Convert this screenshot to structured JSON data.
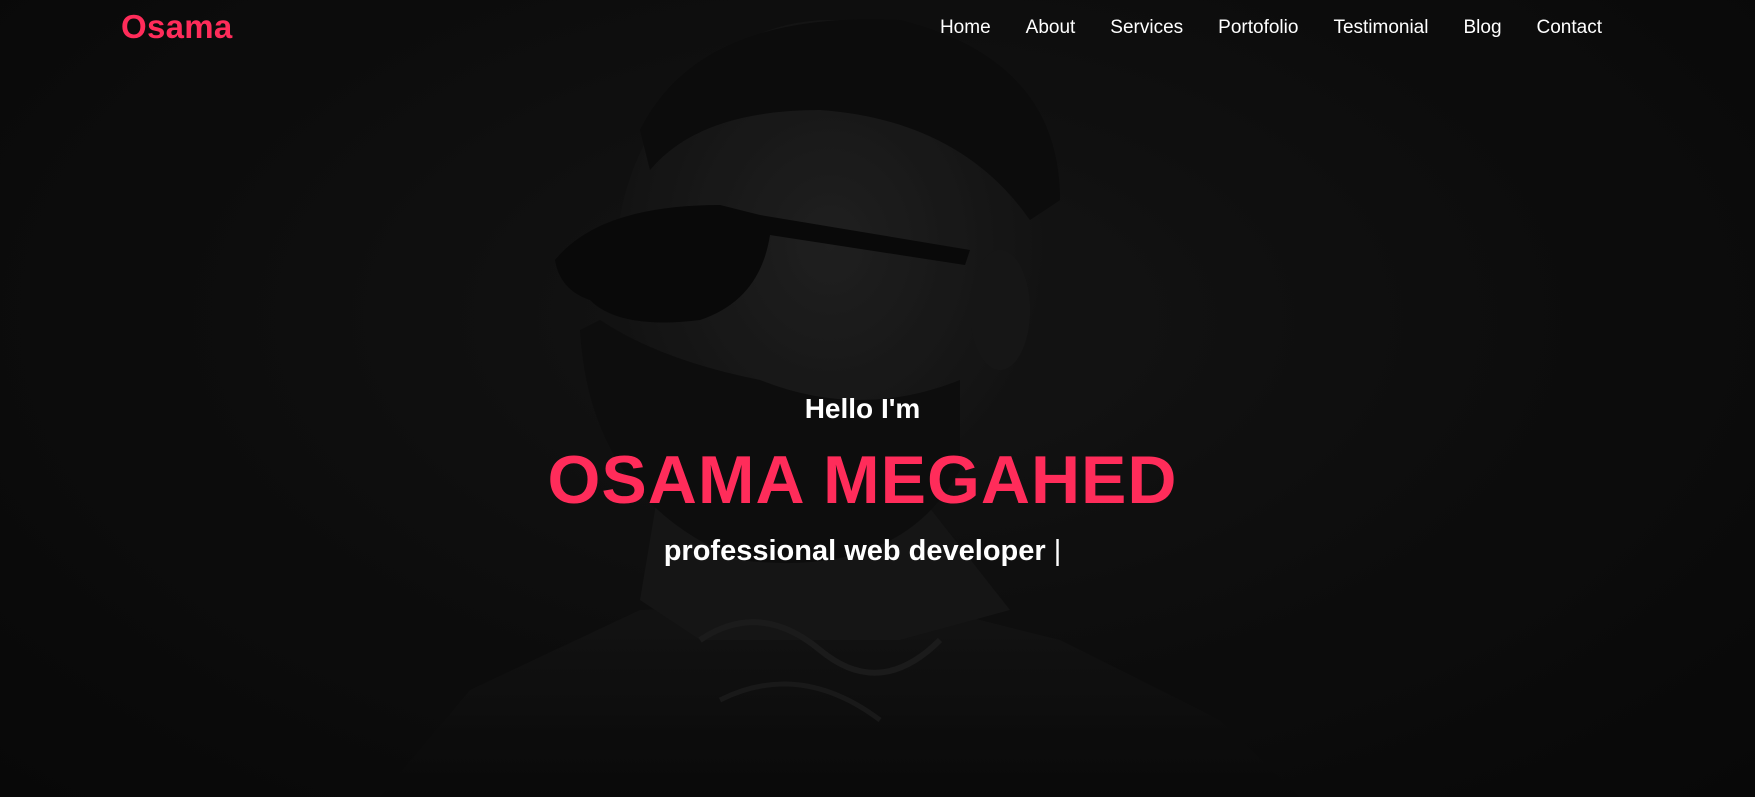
{
  "brand": {
    "logo": "Osama",
    "accent_color": "#ff2c5a"
  },
  "nav": {
    "items": [
      {
        "label": "Home"
      },
      {
        "label": "About"
      },
      {
        "label": "Services"
      },
      {
        "label": "Portofolio"
      },
      {
        "label": "Testimonial"
      },
      {
        "label": "Blog"
      },
      {
        "label": "Contact"
      }
    ]
  },
  "hero": {
    "greeting": "Hello I'm",
    "name": "OSAMA MEGAHED",
    "tagline": "professional web developer",
    "cursor": "|",
    "background_image": "portrait-photo"
  }
}
